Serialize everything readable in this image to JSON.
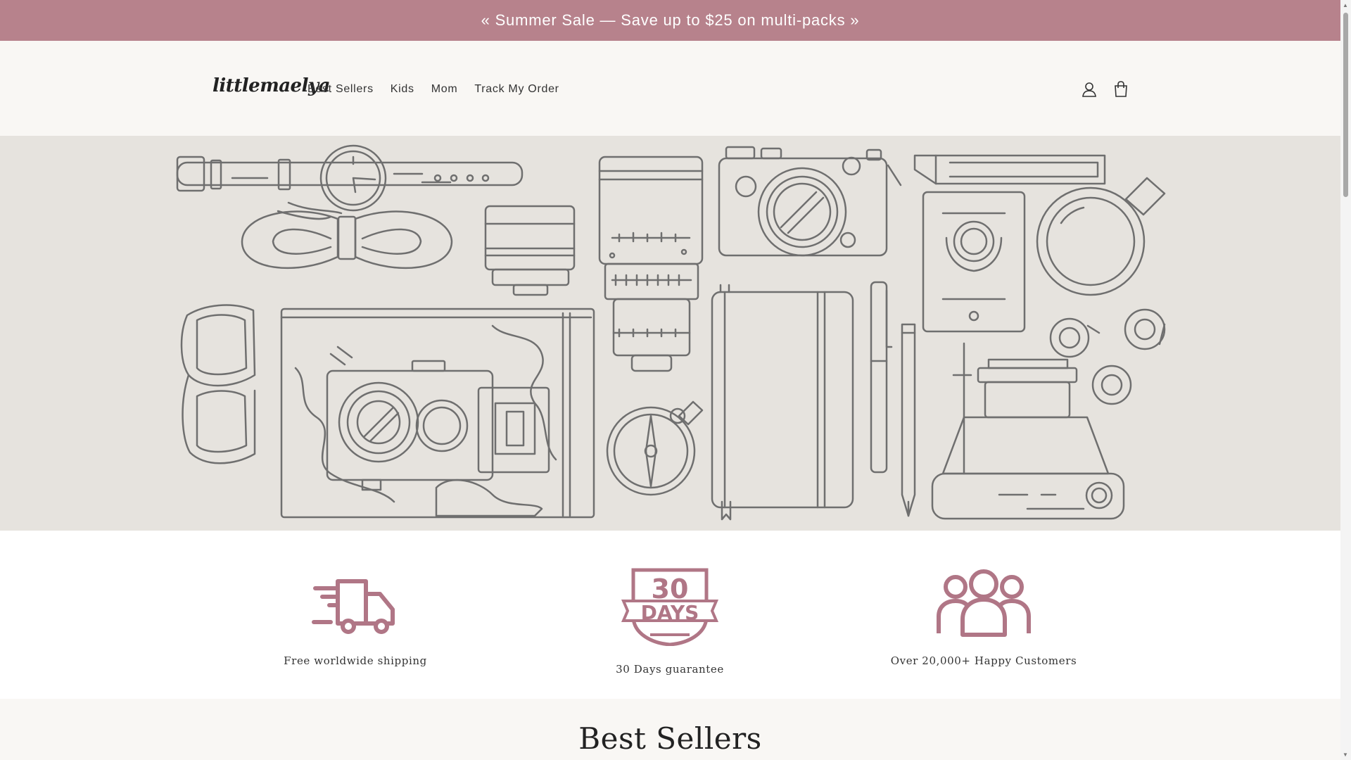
{
  "announcement": {
    "text": "« Summer Sale — Save up to $25 on multi-packs »"
  },
  "header": {
    "logo": "littlemaelya",
    "nav": [
      "Best Sellers",
      "Kids",
      "Mom",
      "Track My Order"
    ],
    "icons": [
      "account-icon",
      "cart-icon"
    ]
  },
  "features": [
    {
      "icon": "truck-icon",
      "label": "Free worldwide shipping"
    },
    {
      "icon": "30-days-badge-icon",
      "label": "30 Days guarantee",
      "badge_top": "30",
      "badge_bottom": "DAYS"
    },
    {
      "icon": "customers-icon",
      "label": "Over 20,000+ Happy Customers"
    }
  ],
  "section": {
    "title": "Best Sellers"
  },
  "colors": {
    "accent": "#b7828c",
    "header_bg": "#f9f7f4",
    "hero_bg": "#e6e3de",
    "icon": "#b07686"
  }
}
